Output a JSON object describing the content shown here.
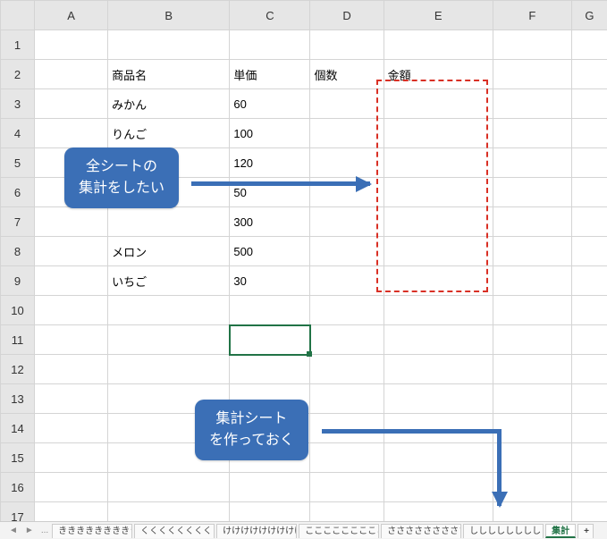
{
  "columns": [
    "A",
    "B",
    "C",
    "D",
    "E",
    "F",
    "G"
  ],
  "rowCount": 17,
  "selected": {
    "col": "C",
    "row": 11
  },
  "table": {
    "header": {
      "B": "商品名",
      "C": "単価",
      "D": "個数",
      "E": "金額"
    },
    "rows": [
      {
        "B": "みかん",
        "C": 60
      },
      {
        "B": "りんご",
        "C": 100
      },
      {
        "B": "",
        "C": 120
      },
      {
        "B": "",
        "C": 50
      },
      {
        "B": "",
        "C": 300
      },
      {
        "B": "メロン",
        "C": 500
      },
      {
        "B": "いちご",
        "C": 30
      }
    ]
  },
  "callouts": {
    "aggregate_all": {
      "line1": "全シートの",
      "line2": "集計をしたい"
    },
    "make_summary": {
      "line1": "集計シート",
      "line2": "を作っておく"
    }
  },
  "tabs": {
    "ellipsis": "...",
    "items": [
      "きききききききききき",
      "くくくくくくくくくく",
      "けけけけけけけけけけ",
      "ここここここここここ",
      "さささささささささささ",
      "しししししししししし",
      "集計"
    ],
    "activeIndex": 6,
    "add": "+"
  }
}
